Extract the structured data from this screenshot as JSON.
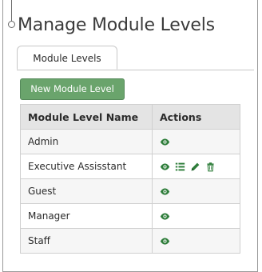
{
  "page": {
    "title": "Manage Module Levels"
  },
  "tabs": [
    {
      "label": "Module Levels",
      "active": true
    }
  ],
  "toolbar": {
    "new_button_label": "New Module Level"
  },
  "table": {
    "columns": [
      "Module Level Name",
      "Actions"
    ],
    "rows": [
      {
        "name": "Admin",
        "actions": [
          "view"
        ]
      },
      {
        "name": "Executive Assisstant",
        "actions": [
          "view",
          "list",
          "edit",
          "delete"
        ]
      },
      {
        "name": "Guest",
        "actions": [
          "view"
        ]
      },
      {
        "name": "Manager",
        "actions": [
          "view"
        ]
      },
      {
        "name": "Staff",
        "actions": [
          "view"
        ]
      }
    ]
  },
  "colors": {
    "primary_button": "#6aa46c",
    "icon_green": "#2e7d3a",
    "header_bg": "#e4e4e4"
  }
}
